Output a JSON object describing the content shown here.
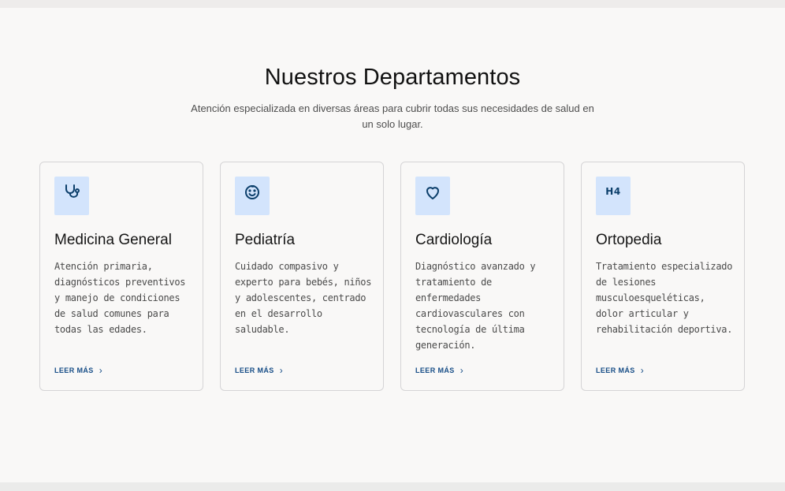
{
  "section": {
    "title": "Nuestros Departamentos",
    "subtitle": "Atención especializada en diversas áreas para cubrir todas sus necesidades de salud en un solo lugar."
  },
  "departments": [
    {
      "icon": "stethoscope-icon",
      "title": "Medicina General",
      "description": "Atención primaria, diagnósticos preventivos y manejo de condiciones de salud comunes para todas las edades.",
      "link": "LEER MÁS"
    },
    {
      "icon": "smiley-face-icon",
      "title": "Pediatría",
      "description": "Cuidado compasivo y experto para bebés, niños y adolescentes, centrado en el desarrollo saludable.",
      "link": "LEER MÁS"
    },
    {
      "icon": "heart-icon",
      "title": "Cardiología",
      "description": "Diagnóstico avanzado y tratamiento de enfermedades cardiovasculares con tecnología de última generación.",
      "link": "LEER MÁS"
    },
    {
      "icon_text": "H4",
      "icon": "bone-icon",
      "title": "Ortopedia",
      "description": "Tratamiento especializado de lesiones musculoesqueléticas, dolor articular y rehabilitación deportiva.",
      "link": "LEER MÁS"
    }
  ],
  "colors": {
    "accent": "#154c86",
    "icon_bg": "#d3e4fc",
    "page_bg": "#f9f8f7"
  }
}
